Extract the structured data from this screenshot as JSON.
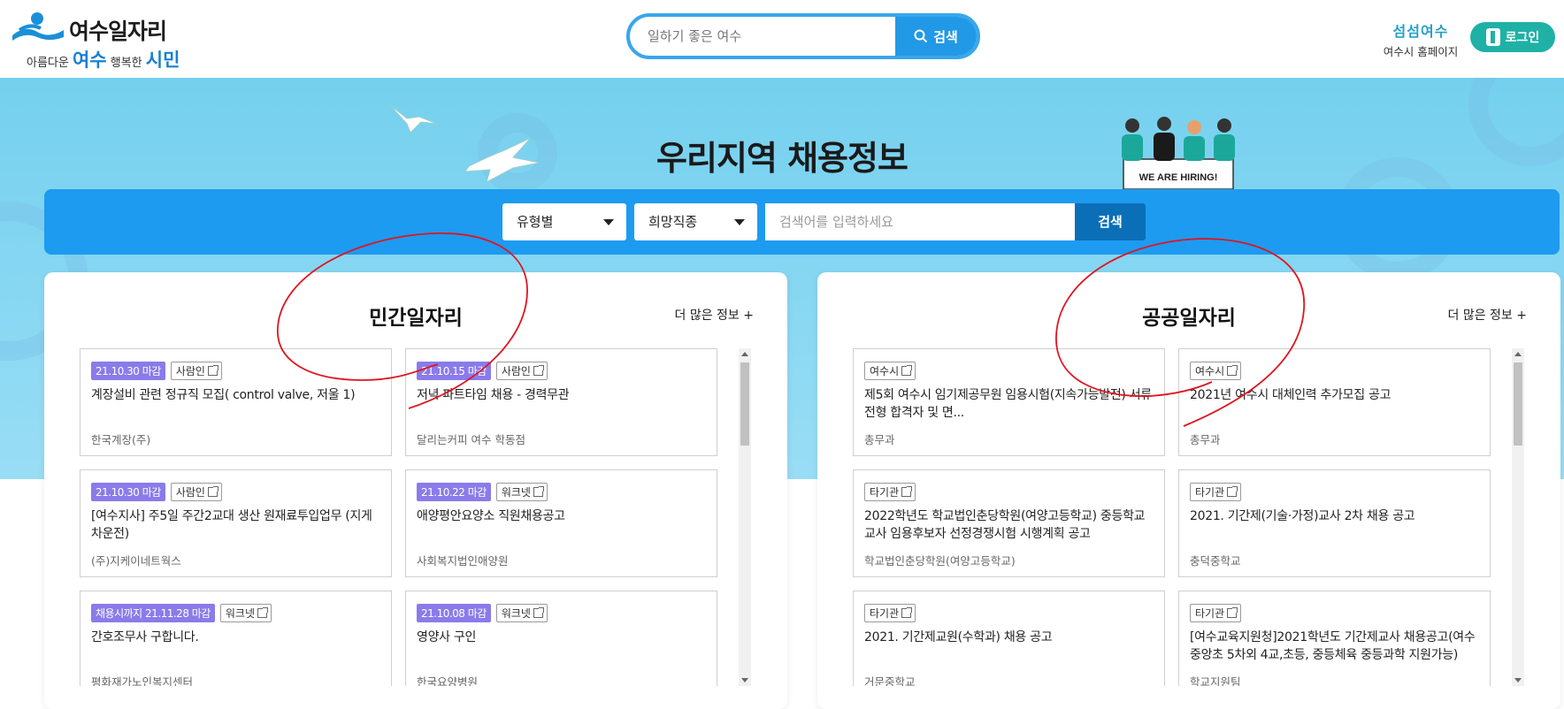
{
  "header": {
    "logo_title": "여수일자리",
    "logo_slogan_pre": "아름다운",
    "logo_slogan_city": "여수",
    "logo_slogan_mid": "행복한",
    "logo_slogan_end": "시민",
    "search_placeholder": "일하기 좋은 여수",
    "search_button": "검색",
    "home_logo": "섬섬여수",
    "home_label": "여수시 홈페이지",
    "login_label": "로그인"
  },
  "hero": {
    "title": "우리지역 채용정보",
    "illustration_text": "WE ARE HIRING!"
  },
  "filter": {
    "type_select": "유형별",
    "job_select": "희망직종",
    "keyword_placeholder": "검색어를 입력하세요",
    "search_button": "검색"
  },
  "private_panel": {
    "title": "민간일자리",
    "more": "더 많은 정보 +",
    "cards": [
      {
        "date": "21.10.30 마감",
        "source": "사람인",
        "title": "계장설비 관련 정규직 모집( control valve, 저울 1)",
        "org": "한국계장(주)"
      },
      {
        "date": "21.10.15 마감",
        "source": "사람인",
        "title": "저녁 파트타임 채용 - 경력무관",
        "org": "달리는커피 여수 학동점"
      },
      {
        "date": "21.10.30 마감",
        "source": "사람인",
        "title": "[여수지사] 주5일 주간2교대 생산 원재료투입업무 (지게차운전)",
        "org": "(주)지케이네트웍스"
      },
      {
        "date": "21.10.22 마감",
        "source": "워크넷",
        "title": "애양평안요양소 직원채용공고",
        "org": "사회복지법인애양원"
      },
      {
        "date": "채용시까지 21.11.28 마감",
        "source": "워크넷",
        "title": "간호조무사 구합니다.",
        "org": "평화재가노인복지센터"
      },
      {
        "date": "21.10.08 마감",
        "source": "워크넷",
        "title": "영양사 구인",
        "org": "한국요양병원"
      }
    ]
  },
  "public_panel": {
    "title": "공공일자리",
    "more": "더 많은 정보 +",
    "cards": [
      {
        "source": "여수시",
        "title": "제5회 여수시 임기제공무원 임용시험(지속가능발전) 서류전형 합격자 및 면...",
        "org": "총무과"
      },
      {
        "source": "여수시",
        "title": "2021년 여수시 대체인력 추가모집 공고",
        "org": "총무과"
      },
      {
        "source": "타기관",
        "title": "2022학년도 학교법인춘당학원(여양고등학교) 중등학교교사 임용후보자 선정경쟁시험 시행계획 공고",
        "org": "학교법인춘당학원(여양고등학교)"
      },
      {
        "source": "타기관",
        "title": "2021. 기간제(기술·가정)교사 2차 채용 공고",
        "org": "충덕중학교"
      },
      {
        "source": "타기관",
        "title": "2021. 기간제교원(수학과) 채용 공고",
        "org": "거문중학교"
      },
      {
        "source": "타기관",
        "title": "[여수교육지원청]2021학년도 기간제교사 채용공고(여수중앙초 5차외 4교,초등, 중등체육 중등과학 지원가능)",
        "org": "학교지원팀"
      }
    ]
  },
  "colors": {
    "accent_blue": "#1d9bf0",
    "dark_blue": "#0b6fb8",
    "date_badge": "#8a7bea",
    "login_green": "#1fb1a6",
    "annotation_red": "#e0141e"
  }
}
